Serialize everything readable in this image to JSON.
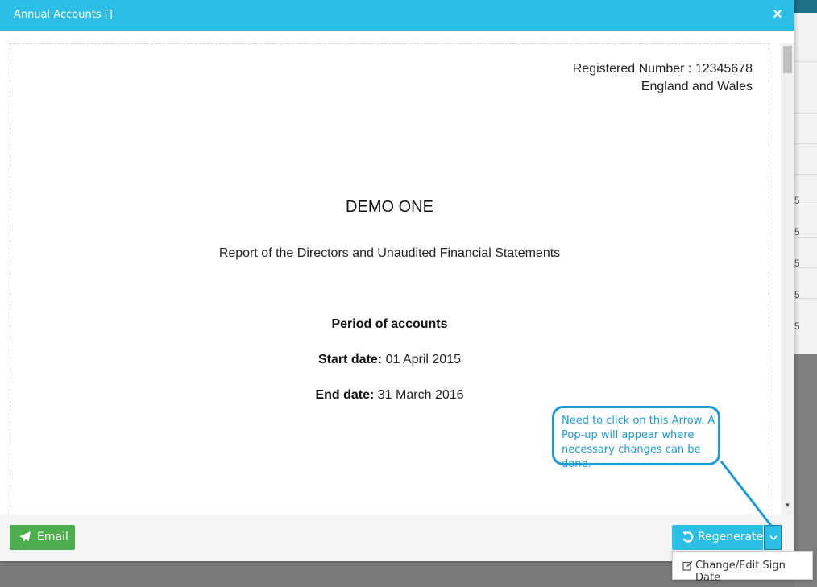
{
  "modal": {
    "title": "Annual Accounts []",
    "close_label": "×"
  },
  "document": {
    "registered_number": "Registered Number : 12345678",
    "jurisdiction": "England and Wales",
    "company_name": "DEMO ONE",
    "report_title": "Report of the Directors and Unaudited Financial Statements",
    "period_heading": "Period of accounts",
    "start_date_label": "Start date:",
    "start_date_value": "01 April 2015",
    "end_date_label": "End date:",
    "end_date_value": "31 March 2016"
  },
  "footer": {
    "email_label": "Email",
    "regenerate_label": "Regenerate"
  },
  "dropdown": {
    "items": [
      {
        "label": "Change/Edit Sign Date"
      }
    ]
  },
  "annotation": {
    "text": "Need to click on this Arrow. A Pop-up will appear where necessary changes can be done."
  },
  "background": {
    "cells": [
      "5",
      "5",
      "5",
      "5",
      "5"
    ]
  },
  "colors": {
    "header": "#2cbfe5",
    "email_button": "#4cae4c",
    "regenerate_button": "#2cbfe5",
    "annotation": "#1a9bd7"
  }
}
